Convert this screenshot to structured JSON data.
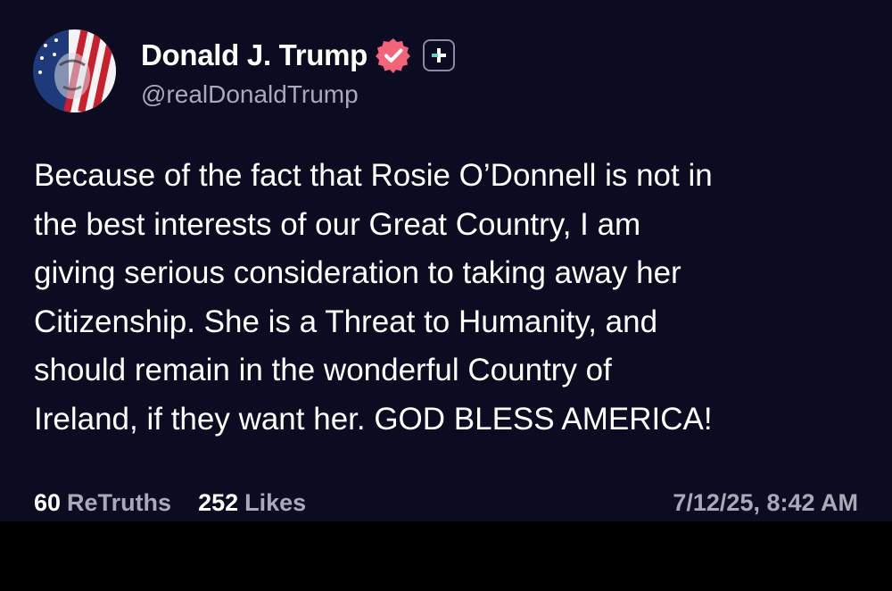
{
  "post": {
    "author": {
      "display_name": "Donald J. Trump",
      "handle": "@realDonaldTrump",
      "avatar_icon": "flag-portrait-avatar",
      "verified_icon": "verified-badge-icon",
      "plus_icon": "plus-badge-icon"
    },
    "body_lines": [
      "Because of the fact that Rosie O’Donnell is not in",
      "the best interests of our Great Country, I am",
      "giving serious consideration to taking away her",
      "Citizenship. She is a Threat to Humanity, and",
      "should remain in the wonderful Country of",
      "Ireland, if they want her. GOD BLESS AMERICA!"
    ],
    "stats": {
      "retruths_count": "60",
      "retruths_label": "ReTruths",
      "likes_count": "252",
      "likes_label": "Likes"
    },
    "timestamp": "7/12/25, 8:42 AM"
  },
  "colors": {
    "background": "#0b0b22",
    "text_primary": "#ffffff",
    "text_secondary": "#a9a9b8",
    "verified_badge": "#f3637a",
    "plus_accent": "#5ad6c5"
  }
}
